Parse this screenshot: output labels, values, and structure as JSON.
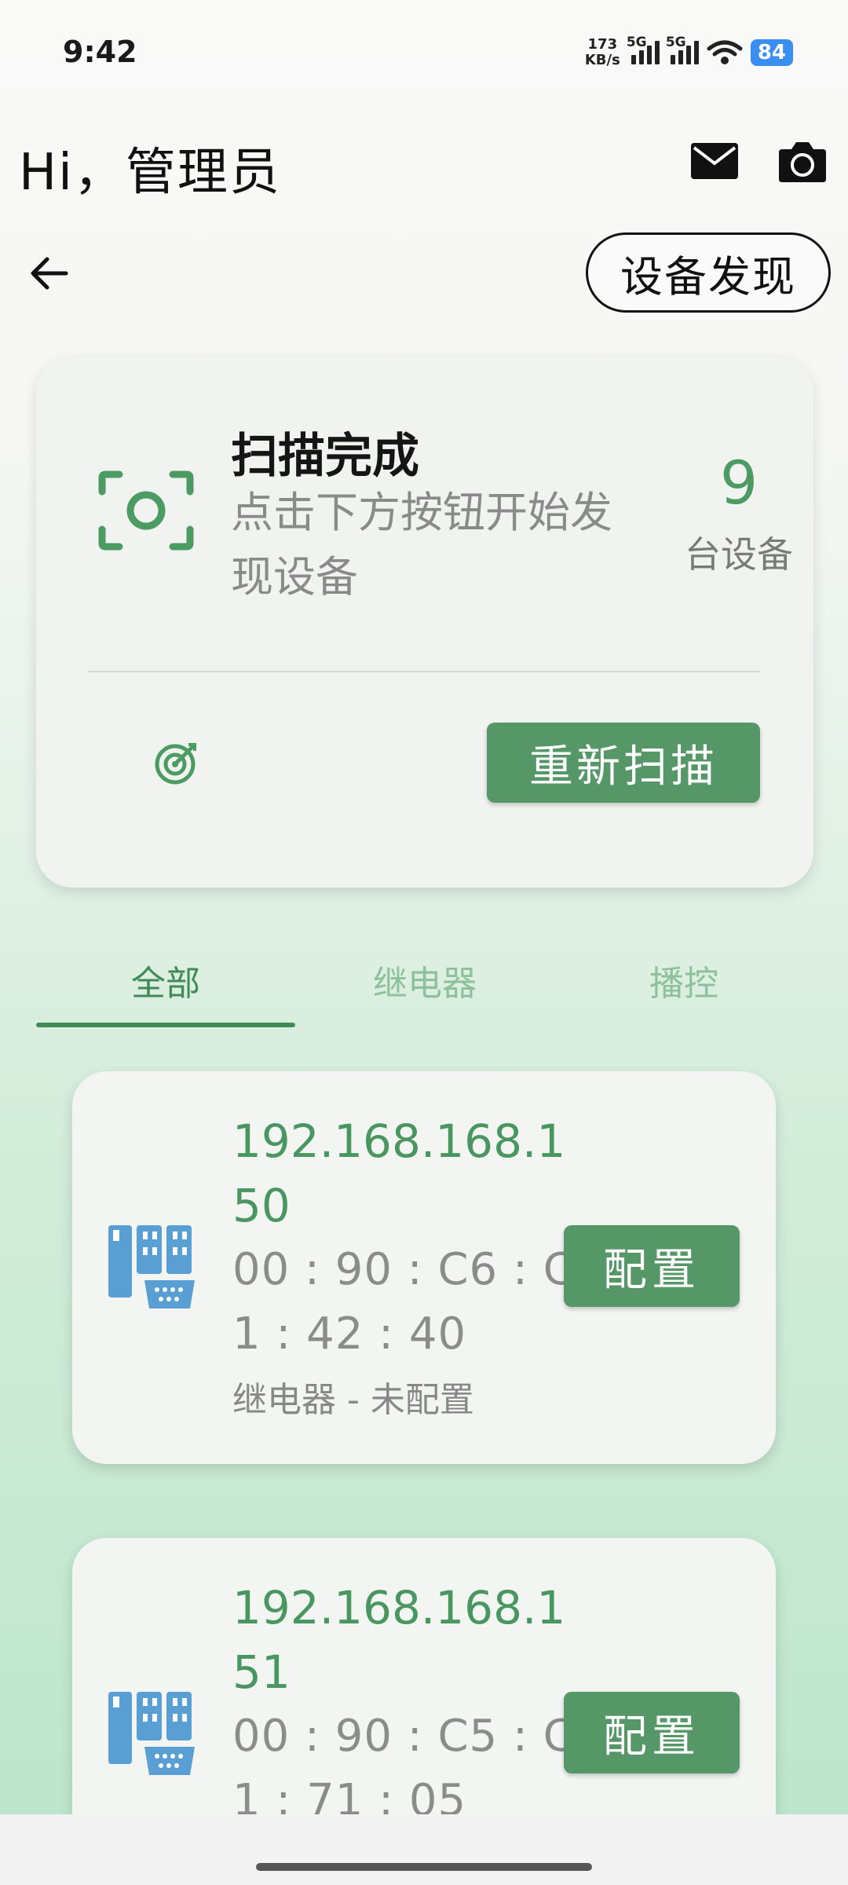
{
  "status_bar": {
    "time": "9:42",
    "net_speed_value": "173",
    "net_speed_unit": "KB/s",
    "signal1_label": "5G",
    "signal2_label": "5G",
    "battery": "84"
  },
  "header": {
    "greeting": "Hi，管理员",
    "mail_icon": "mail-icon",
    "camera_icon": "camera-icon"
  },
  "nav": {
    "back_icon": "back-arrow-icon",
    "page_title": "设备发现"
  },
  "scan": {
    "title": "扫描完成",
    "subtitle": "点击下方按钮开始发现设备",
    "count": "9",
    "count_label": "台设备",
    "rescan_label": "重新扫描"
  },
  "tabs": [
    {
      "label": "全部",
      "active": true
    },
    {
      "label": "继电器",
      "active": false
    },
    {
      "label": "播控",
      "active": false
    }
  ],
  "devices": [
    {
      "ip": "192.168.168.150",
      "mac": "00 : 90 : C6 : C1 : 42 : 40",
      "type": "继电器 - 未配置",
      "config_label": "配置"
    },
    {
      "ip": "192.168.168.151",
      "mac": "00 : 90 : C5 : C1 : 71 : 05",
      "type": "",
      "config_label": "配置"
    }
  ],
  "colors": {
    "accent": "#559766",
    "accent_text": "#4a9660",
    "device_icon": "#5a9fd4"
  }
}
